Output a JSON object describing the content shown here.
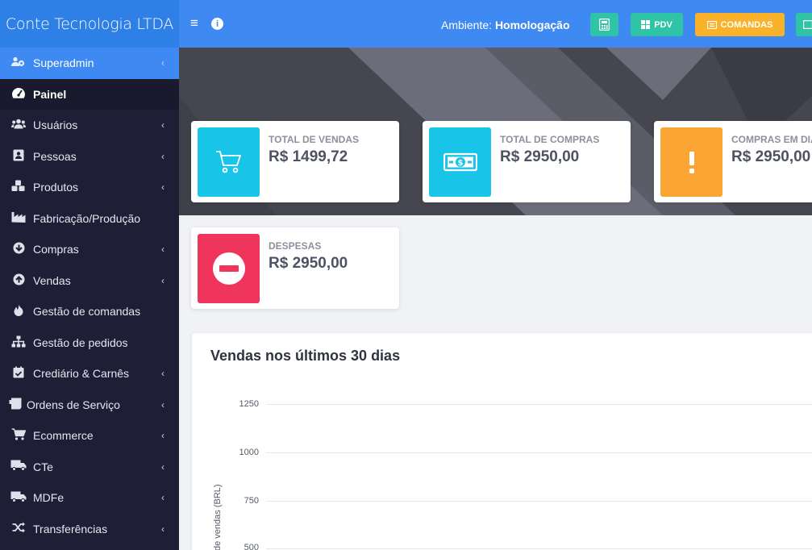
{
  "brand": "Conte Tecnologia LTDA",
  "topbar": {
    "menu_icon": "≡",
    "info_icon": "i",
    "env_label": "Ambiente:",
    "env_value": "Homologação",
    "pdv_label": "PDV",
    "comandas_label": "COMANDAS"
  },
  "sidebar": {
    "items": [
      {
        "label": "Superadmin",
        "icon": "users-cog-icon"
      },
      {
        "label": "Painel",
        "icon": "tachometer-icon"
      },
      {
        "label": "Usuários",
        "icon": "users-icon"
      },
      {
        "label": "Pessoas",
        "icon": "address-card-icon"
      },
      {
        "label": "Produtos",
        "icon": "cubes-icon"
      },
      {
        "label": "Fabricação/Produção",
        "icon": "industry-icon"
      },
      {
        "label": "Compras",
        "icon": "arrow-down-circle-icon"
      },
      {
        "label": "Vendas",
        "icon": "arrow-up-circle-icon"
      },
      {
        "label": "Gestão de comandas",
        "icon": "fire-icon"
      },
      {
        "label": "Gestão de pedidos",
        "icon": "sitemap-icon"
      },
      {
        "label": "Crediário & Carnês",
        "icon": "calendar-check-icon"
      },
      {
        "label": "Ordens de Serviço",
        "icon": "receipt-icon"
      },
      {
        "label": "Ecommerce",
        "icon": "shopping-cart-icon"
      },
      {
        "label": "CTe",
        "icon": "truck-icon"
      },
      {
        "label": "MDFe",
        "icon": "truck-icon"
      },
      {
        "label": "Transferências",
        "icon": "random-icon"
      }
    ]
  },
  "cards": {
    "vendas": {
      "label": "TOTAL DE VENDAS",
      "value": "R$ 1499,72"
    },
    "compras": {
      "label": "TOTAL DE COMPRAS",
      "value": "R$ 2950,00"
    },
    "compras_dia": {
      "label": "COMPRAS EM DIA",
      "value": "R$ 2950,00"
    },
    "despesas": {
      "label": "DESPESAS",
      "value": "R$ 2950,00"
    }
  },
  "chart": {
    "title": "Vendas nos últimos 30 dias",
    "ylabel": "de vendas (BRL)",
    "ticks": [
      "1250",
      "1000",
      "750",
      "500"
    ]
  },
  "colors": {
    "accent": "#3f8af2",
    "sidebar": "#1e1f37",
    "teal": "#2ec4a5",
    "cyan": "#18c5e8",
    "orange": "#fba535",
    "red": "#f0355c"
  }
}
